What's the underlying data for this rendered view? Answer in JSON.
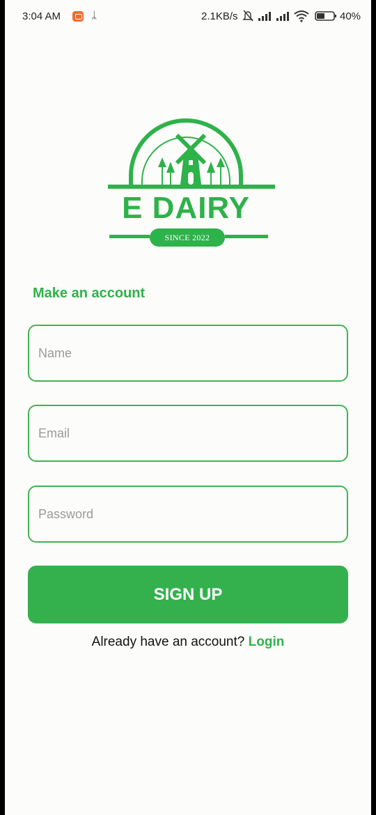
{
  "status_bar": {
    "time": "3:04 AM",
    "usb_glyph": "ᛦ",
    "net_speed": "2.1KB/s",
    "battery": "40%",
    "icons": [
      "screen-record-icon",
      "usb-icon",
      "mute-icon",
      "signal-icon",
      "signal-icon",
      "wifi-icon",
      "battery-icon"
    ]
  },
  "logo": {
    "title": "E DAIRY",
    "since": "SINCE 2022",
    "icon": "windmill-logo-icon"
  },
  "form": {
    "heading": "Make an account",
    "name_placeholder": "Name",
    "email_placeholder": "Email",
    "password_placeholder": "Password",
    "submit_label": "SIGN UP",
    "login_prompt": "Already have an account?",
    "login_link": "Login"
  },
  "colors": {
    "accent": "#2eb24a",
    "background": "#fcfcfa"
  }
}
